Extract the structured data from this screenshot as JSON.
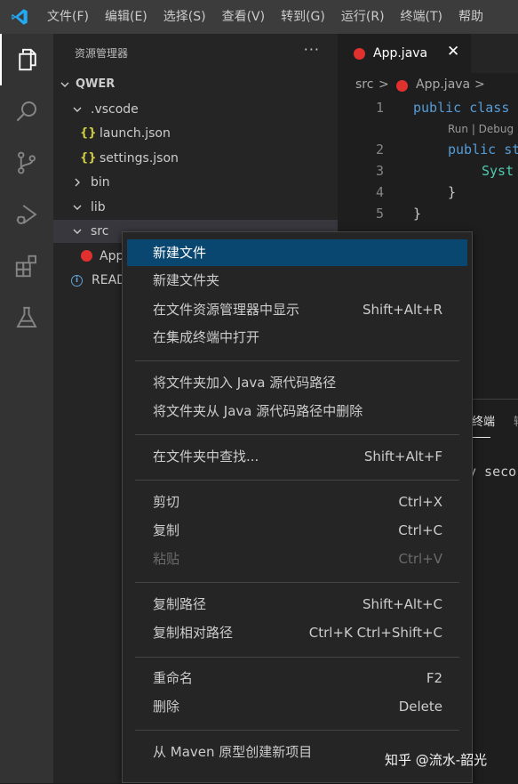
{
  "menubar": {
    "items": [
      "文件(F)",
      "编辑(E)",
      "选择(S)",
      "查看(V)",
      "转到(G)",
      "运行(R)",
      "终端(T)",
      "帮助"
    ]
  },
  "activity_bar": {
    "icons": [
      "explorer-icon",
      "search-icon",
      "source-control-icon",
      "run-debug-icon",
      "extensions-icon",
      "testing-icon"
    ]
  },
  "sidebar": {
    "header": "资源管理器",
    "more": "···",
    "root": "QWER",
    "items": [
      {
        "label": ".vscode",
        "kind": "folder",
        "expanded": true
      },
      {
        "label": "launch.json",
        "kind": "json"
      },
      {
        "label": "settings.json",
        "kind": "json"
      },
      {
        "label": "bin",
        "kind": "folder",
        "expanded": false
      },
      {
        "label": "lib",
        "kind": "folder",
        "expanded": true
      },
      {
        "label": "src",
        "kind": "folder",
        "expanded": true
      },
      {
        "label": "App",
        "kind": "java"
      },
      {
        "label": "READ",
        "kind": "info"
      }
    ]
  },
  "editor": {
    "tab_label": "App.java",
    "tab_close": "✕",
    "breadcrumb": {
      "part1": "src",
      "sep": ">",
      "part2": "App.java",
      "sep2": ">"
    },
    "lines": [
      {
        "num": "1",
        "kw": "public class",
        "rest": ""
      },
      {
        "lens": "Run | Debug"
      },
      {
        "num": "2",
        "kw": "public st",
        "rest": ""
      },
      {
        "num": "3",
        "type": "Syst",
        "rest": ""
      },
      {
        "num": "4",
        "punct": "}"
      },
      {
        "num": "5",
        "punct": "}"
      }
    ]
  },
  "panel": {
    "tab_active": "终端",
    "tab_next": "输",
    "terminal_text": "y seco"
  },
  "context_menu": {
    "items": [
      {
        "label": "新建文件",
        "shortcut": "",
        "highlighted": true
      },
      {
        "label": "新建文件夹",
        "shortcut": ""
      },
      {
        "label": "在文件资源管理器中显示",
        "shortcut": "Shift+Alt+R"
      },
      {
        "label": "在集成终端中打开",
        "shortcut": ""
      },
      {
        "label": "将文件夹加入 Java 源代码路径",
        "shortcut": ""
      },
      {
        "label": "将文件夹从 Java 源代码路径中删除",
        "shortcut": ""
      },
      {
        "label": "在文件夹中查找...",
        "shortcut": "Shift+Alt+F"
      },
      {
        "label": "剪切",
        "shortcut": "Ctrl+X"
      },
      {
        "label": "复制",
        "shortcut": "Ctrl+C"
      },
      {
        "label": "粘贴",
        "shortcut": "Ctrl+V",
        "disabled": true
      },
      {
        "label": "复制路径",
        "shortcut": "Shift+Alt+C"
      },
      {
        "label": "复制相对路径",
        "shortcut": "Ctrl+K Ctrl+Shift+C"
      },
      {
        "label": "重命名",
        "shortcut": "F2"
      },
      {
        "label": "删除",
        "shortcut": "Delete"
      },
      {
        "label": "从 Maven 原型创建新项目",
        "shortcut": ""
      }
    ]
  },
  "watermark": "知乎 @流水-韶光",
  "colors": {
    "highlight": "#094771",
    "java_icon": "#e0312f",
    "json_icon": "#cbcb41",
    "vscode_logo": "#23a9f2"
  }
}
